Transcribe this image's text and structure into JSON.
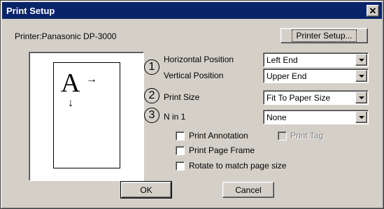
{
  "window": {
    "title": "Print Setup",
    "close_glyph": "✕"
  },
  "printer": {
    "label": "Printer:Panasonic DP-3000",
    "setup_button": "Printer Setup..."
  },
  "preview": {
    "letter": "A",
    "right_arrow_icon": "→",
    "down_arrow_icon": "↓"
  },
  "markers": [
    "1",
    "2",
    "3"
  ],
  "fields": {
    "horizontal": {
      "label": "Horizontal Position",
      "value": "Left End"
    },
    "vertical": {
      "label": "Vertical Position",
      "value": "Upper End"
    },
    "size": {
      "label": "Print Size",
      "value": "Fit To Paper Size"
    },
    "nin1": {
      "label": "N in 1",
      "value": "None"
    }
  },
  "options": {
    "annotation": {
      "label": "Print Annotation",
      "checked": false
    },
    "tag": {
      "label": "Print Tag",
      "checked": false,
      "disabled": true
    },
    "frame": {
      "label": "Print Page Frame",
      "checked": false
    },
    "rotate": {
      "label": "Rotate to match page size",
      "checked": false
    }
  },
  "buttons": {
    "ok": "OK",
    "cancel": "Cancel"
  }
}
